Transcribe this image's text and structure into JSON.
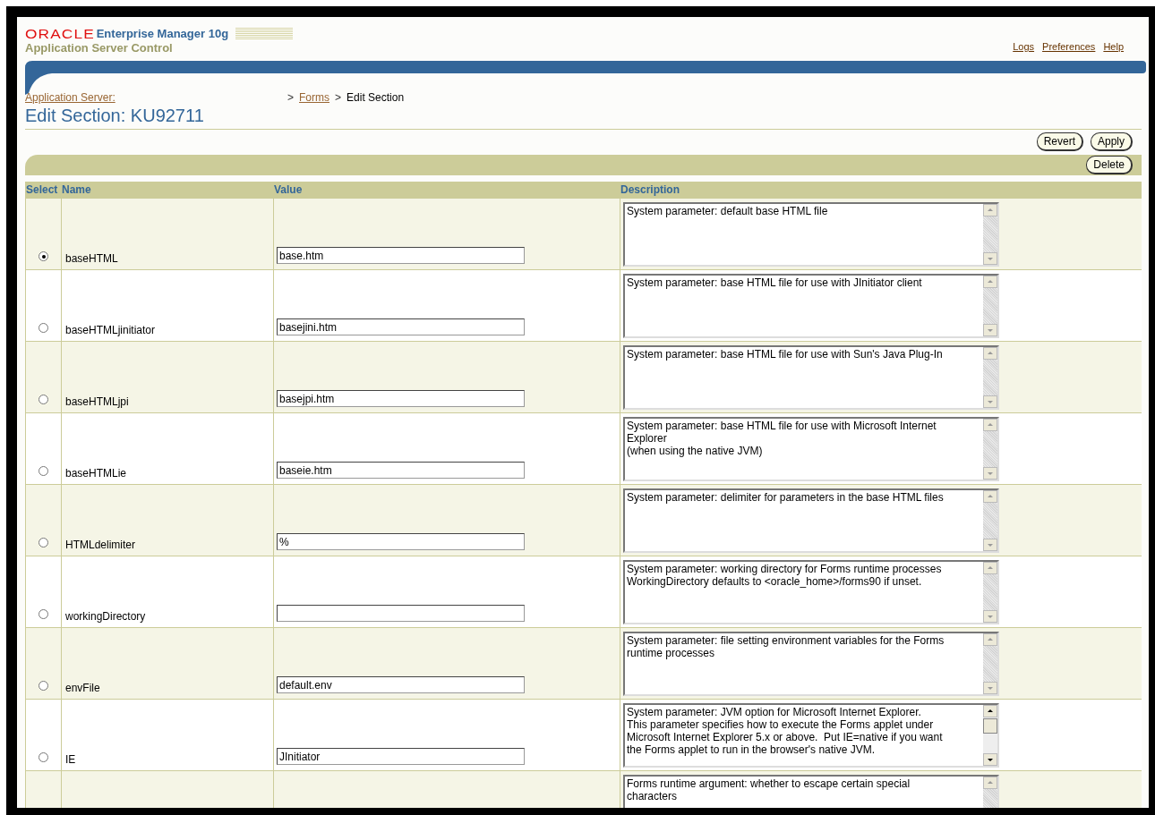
{
  "header": {
    "brand": "ORACLE",
    "product": "Enterprise Manager 10g",
    "subtitle": "Application Server Control",
    "links": [
      "Logs",
      "Preferences",
      "Help"
    ]
  },
  "breadcrumb": {
    "items": [
      "Application Server:",
      "Forms"
    ],
    "current": "Edit Section",
    "separator": ">"
  },
  "page_title": "Edit Section: KU92711",
  "actions": [
    "Revert",
    "Apply"
  ],
  "table_actions": [
    "Delete"
  ],
  "table": {
    "columns": [
      "Select",
      "Name",
      "Value",
      "Description"
    ],
    "rows": [
      {
        "selected": true,
        "name": "baseHTML",
        "value": "base.htm",
        "description": "System parameter: default base HTML file",
        "scrollable": false
      },
      {
        "selected": false,
        "name": "baseHTMLjinitiator",
        "value": "basejini.htm",
        "description": "System parameter: base HTML file for use with JInitiator client",
        "scrollable": false
      },
      {
        "selected": false,
        "name": "baseHTMLjpi",
        "value": "basejpi.htm",
        "description": "System parameter: base HTML file for use with Sun's Java Plug-In",
        "scrollable": false
      },
      {
        "selected": false,
        "name": "baseHTMLie",
        "value": "baseie.htm",
        "description": "System parameter: base HTML file for use with Microsoft Internet\nExplorer\n(when using the native JVM)",
        "scrollable": false
      },
      {
        "selected": false,
        "name": "HTMLdelimiter",
        "value": "%",
        "description": "System parameter: delimiter for parameters in the base HTML files",
        "scrollable": false
      },
      {
        "selected": false,
        "name": "workingDirectory",
        "description": "System parameter: working directory for Forms runtime processes\nWorkingDirectory defaults to <oracle_home>/forms90 if unset.",
        "scrollable": false
      },
      {
        "selected": false,
        "name": "envFile",
        "value": "default.env",
        "description": "System parameter: file setting environment variables for the Forms\nruntime processes",
        "scrollable": false
      },
      {
        "selected": false,
        "name": "IE",
        "value": "JInitiator",
        "description": "System parameter: JVM option for Microsoft Internet Explorer.\nThis parameter specifies how to execute the Forms applet under\nMicrosoft Internet Explorer 5.x or above.  Put IE=native if you want\nthe Forms applet to run in the browser's native JVM.",
        "scrollable": true
      },
      {
        "description": "Forms runtime argument: whether to escape certain special\ncharacters",
        "scrollable": false
      }
    ]
  }
}
